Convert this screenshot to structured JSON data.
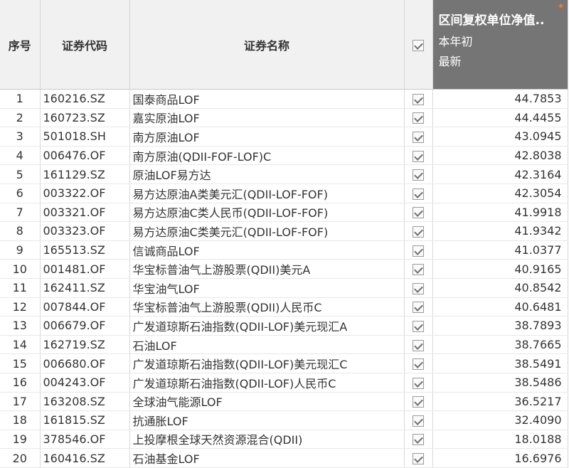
{
  "header": {
    "index": "序号",
    "code": "证券代码",
    "name": "证券名称",
    "metric_title": "区间复权单位净值..",
    "metric_period": "本年初",
    "metric_latest": "最新",
    "star": "★"
  },
  "rows": [
    {
      "index": "1",
      "code": "160216.SZ",
      "name": "国泰商品LOF",
      "value": "44.7853"
    },
    {
      "index": "2",
      "code": "160723.SZ",
      "name": "嘉实原油LOF",
      "value": "44.4455"
    },
    {
      "index": "3",
      "code": "501018.SH",
      "name": "南方原油LOF",
      "value": "43.0945"
    },
    {
      "index": "4",
      "code": "006476.OF",
      "name": "南方原油(QDII-FOF-LOF)C",
      "value": "42.8038"
    },
    {
      "index": "5",
      "code": "161129.SZ",
      "name": "原油LOF易方达",
      "value": "42.3164"
    },
    {
      "index": "6",
      "code": "003322.OF",
      "name": "易方达原油A类美元汇(QDII-LOF-FOF)",
      "value": "42.3054"
    },
    {
      "index": "7",
      "code": "003321.OF",
      "name": "易方达原油C类人民币(QDII-LOF-FOF)",
      "value": "41.9918"
    },
    {
      "index": "8",
      "code": "003323.OF",
      "name": "易方达原油C类美元汇(QDII-LOF-FOF)",
      "value": "41.9342"
    },
    {
      "index": "9",
      "code": "165513.SZ",
      "name": "信诚商品LOF",
      "value": "41.0377"
    },
    {
      "index": "10",
      "code": "001481.OF",
      "name": "华宝标普油气上游股票(QDII)美元A",
      "value": "40.9165"
    },
    {
      "index": "11",
      "code": "162411.SZ",
      "name": "华宝油气LOF",
      "value": "40.8542"
    },
    {
      "index": "12",
      "code": "007844.OF",
      "name": "华宝标普油气上游股票(QDII)人民币C",
      "value": "40.6481"
    },
    {
      "index": "13",
      "code": "006679.OF",
      "name": "广发道琼斯石油指数(QDII-LOF)美元现汇A",
      "value": "38.7893"
    },
    {
      "index": "14",
      "code": "162719.SZ",
      "name": "石油LOF",
      "value": "38.7665"
    },
    {
      "index": "15",
      "code": "006680.OF",
      "name": "广发道琼斯石油指数(QDII-LOF)美元现汇C",
      "value": "38.5491"
    },
    {
      "index": "16",
      "code": "004243.OF",
      "name": "广发道琼斯石油指数(QDII-LOF)人民币C",
      "value": "38.5486"
    },
    {
      "index": "17",
      "code": "163208.SZ",
      "name": "全球油气能源LOF",
      "value": "36.5217"
    },
    {
      "index": "18",
      "code": "161815.SZ",
      "name": "抗通胀LOF",
      "value": "32.4090"
    },
    {
      "index": "19",
      "code": "378546.OF",
      "name": "上投摩根全球天然资源混合(QDII)",
      "value": "18.0188"
    },
    {
      "index": "20",
      "code": "160416.SZ",
      "name": "石油基金LOF",
      "value": "16.6976"
    }
  ]
}
